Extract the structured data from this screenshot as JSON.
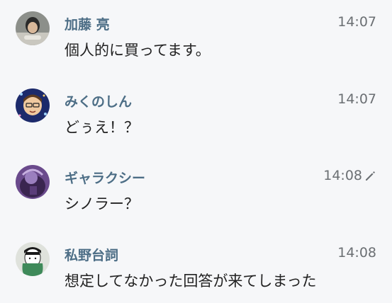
{
  "messages": [
    {
      "user": "加藤 亮",
      "time": "14:07",
      "text": "個人的に買ってます。",
      "edited": false,
      "avatar": "user-photo-avatar"
    },
    {
      "user": "みくのしん",
      "time": "14:07",
      "text": "どぅえ！？",
      "edited": false,
      "avatar": "user-illustration-avatar"
    },
    {
      "user": "ギャラクシー",
      "time": "14:08",
      "text": "シノラー？",
      "edited": true,
      "avatar": "user-purple-avatar"
    },
    {
      "user": "私野台詞",
      "time": "14:08",
      "text": "想定してなかった回答が来てしまった",
      "edited": false,
      "avatar": "user-drawing-avatar"
    }
  ],
  "icons": {
    "edit": "pencil-icon"
  },
  "colors": {
    "username": "#4d6e86",
    "timestamp": "#6b6f73",
    "text": "#222222",
    "background": "#f6f7f9"
  }
}
